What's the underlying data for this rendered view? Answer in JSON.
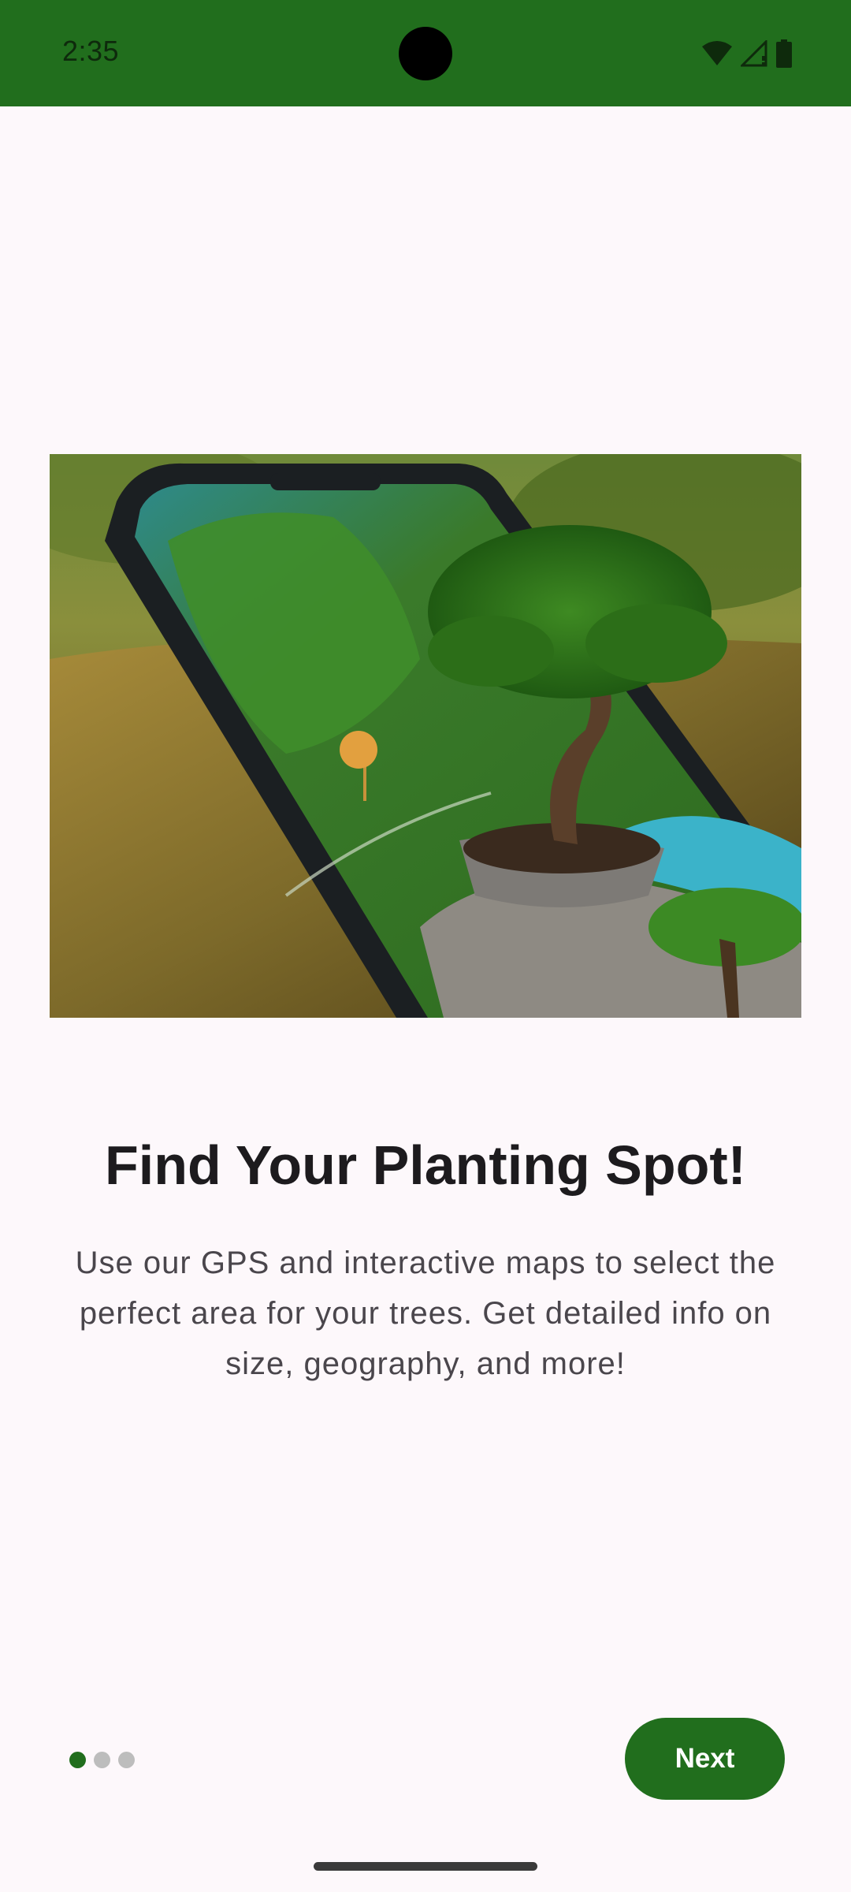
{
  "status_bar": {
    "time": "2:35",
    "background_color": "#216e1d",
    "icons": [
      "wifi-icon",
      "signal-icon",
      "battery-icon"
    ]
  },
  "onboarding": {
    "image": "phone-map-bonsai-illustration",
    "title": "Find Your Planting Spot!",
    "description": "Use our GPS and interactive maps to select the perfect area for your trees. Get detailed info on size, geography, and more!",
    "page_indicator": {
      "total": 3,
      "current": 1,
      "active_color": "#216e1d",
      "inactive_color": "#bdbdbd"
    },
    "next_button": {
      "label": "Next",
      "color": "#216e1d"
    }
  }
}
